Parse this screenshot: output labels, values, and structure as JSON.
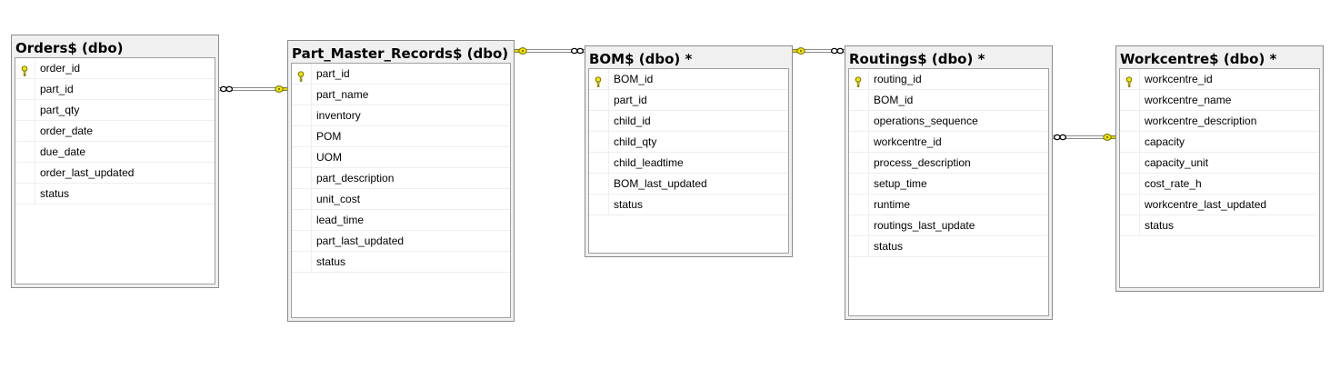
{
  "tables": [
    {
      "name": "Orders$ (dbo)",
      "modified": false,
      "columns": [
        {
          "name": "order_id",
          "pk": true
        },
        {
          "name": "part_id",
          "pk": false
        },
        {
          "name": "part_qty",
          "pk": false
        },
        {
          "name": "order_date",
          "pk": false
        },
        {
          "name": "due_date",
          "pk": false
        },
        {
          "name": "order_last_updated",
          "pk": false
        },
        {
          "name": "status",
          "pk": false
        }
      ]
    },
    {
      "name": "Part_Master_Records$ (dbo) *",
      "modified": true,
      "columns": [
        {
          "name": "part_id",
          "pk": true
        },
        {
          "name": "part_name",
          "pk": false
        },
        {
          "name": "inventory",
          "pk": false
        },
        {
          "name": "POM",
          "pk": false
        },
        {
          "name": "UOM",
          "pk": false
        },
        {
          "name": "part_description",
          "pk": false
        },
        {
          "name": "unit_cost",
          "pk": false
        },
        {
          "name": "lead_time",
          "pk": false
        },
        {
          "name": "part_last_updated",
          "pk": false
        },
        {
          "name": "status",
          "pk": false
        }
      ]
    },
    {
      "name": "BOM$ (dbo) *",
      "modified": true,
      "columns": [
        {
          "name": "BOM_id",
          "pk": true
        },
        {
          "name": "part_id",
          "pk": false
        },
        {
          "name": "child_id",
          "pk": false
        },
        {
          "name": "child_qty",
          "pk": false
        },
        {
          "name": "child_leadtime",
          "pk": false
        },
        {
          "name": "BOM_last_updated",
          "pk": false
        },
        {
          "name": "status",
          "pk": false
        }
      ]
    },
    {
      "name": "Routings$ (dbo) *",
      "modified": true,
      "columns": [
        {
          "name": "routing_id",
          "pk": true
        },
        {
          "name": "BOM_id",
          "pk": false
        },
        {
          "name": "operations_sequence",
          "pk": false
        },
        {
          "name": "workcentre_id",
          "pk": false
        },
        {
          "name": "process_description",
          "pk": false
        },
        {
          "name": "setup_time",
          "pk": false
        },
        {
          "name": "runtime",
          "pk": false
        },
        {
          "name": "routings_last_update",
          "pk": false
        },
        {
          "name": "status",
          "pk": false
        }
      ]
    },
    {
      "name": "Workcentre$ (dbo) *",
      "modified": true,
      "columns": [
        {
          "name": "workcentre_id",
          "pk": true
        },
        {
          "name": "workcentre_name",
          "pk": false
        },
        {
          "name": "workcentre_description",
          "pk": false
        },
        {
          "name": "capacity",
          "pk": false
        },
        {
          "name": "capacity_unit",
          "pk": false
        },
        {
          "name": "cost_rate_h",
          "pk": false
        },
        {
          "name": "workcentre_last_updated",
          "pk": false
        },
        {
          "name": "status",
          "pk": false
        }
      ]
    }
  ],
  "relationships": [
    {
      "from": "Orders$ (dbo)",
      "to": "Part_Master_Records$ (dbo) *",
      "many_side": "Orders$ (dbo)",
      "one_side": "Part_Master_Records$ (dbo) *"
    },
    {
      "from": "Part_Master_Records$ (dbo) *",
      "to": "BOM$ (dbo) *",
      "many_side": "BOM$ (dbo) *",
      "one_side": "Part_Master_Records$ (dbo) *"
    },
    {
      "from": "BOM$ (dbo) *",
      "to": "Routings$ (dbo) *",
      "many_side": "Routings$ (dbo) *",
      "one_side": "BOM$ (dbo) *"
    },
    {
      "from": "Routings$ (dbo) *",
      "to": "Workcentre$ (dbo) *",
      "many_side": "Routings$ (dbo) *",
      "one_side": "Workcentre$ (dbo) *"
    }
  ],
  "icons": {
    "primary_key": "key-icon",
    "one_end": "key-icon",
    "many_end": "infinity-icon"
  },
  "colors": {
    "key_fill": "#f2e600",
    "key_stroke": "#6e6a00",
    "line": "#8a8a8a",
    "panel": "#f0f0f0",
    "border": "#8c8c8c"
  }
}
